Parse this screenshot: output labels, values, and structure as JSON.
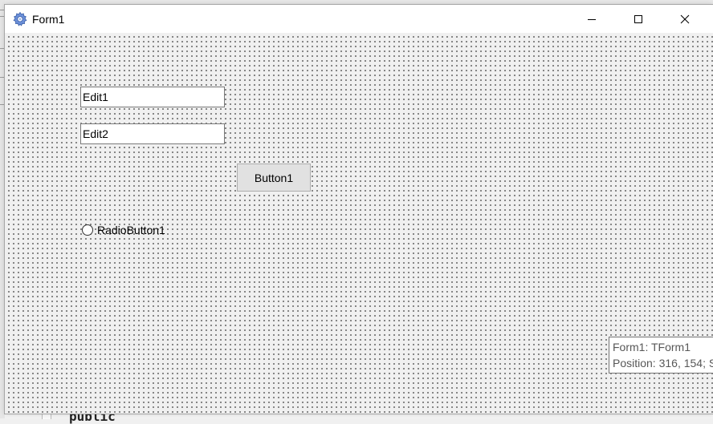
{
  "window": {
    "title": "Form1",
    "icon": "gear-icon",
    "caption_buttons": [
      "minimize-icon",
      "maximize-icon",
      "close-icon"
    ]
  },
  "form": {
    "edit1": {
      "value": "Edit1"
    },
    "edit2": {
      "value": "Edit2"
    },
    "button1": {
      "label": "Button1"
    },
    "radio1": {
      "label": "RadioButton1",
      "checked": false
    }
  },
  "hint": {
    "line1": "Form1: TForm1",
    "line2": "Position: 316, 154; S"
  },
  "ide": {
    "code_fragment": "public"
  }
}
